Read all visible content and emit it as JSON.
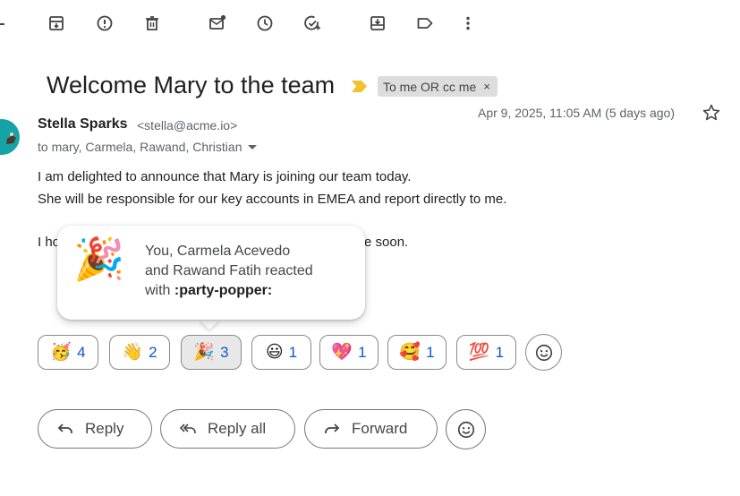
{
  "toolbar": {
    "icons": [
      "archive-icon",
      "report-spam-icon",
      "delete-icon",
      "mark-unread-icon",
      "snooze-icon",
      "add-to-tasks-icon",
      "move-to-icon",
      "label-icon",
      "more-icon"
    ]
  },
  "email": {
    "subject": "Welcome Mary to the team",
    "label_chip": "To me OR cc me",
    "label_chip_close": "×",
    "sender_name": "Stella Sparks",
    "sender_email": "<stella@acme.io>",
    "recipients": "to mary, Carmela, Rawand, Christian",
    "date": "Apr 9, 2025, 11:05 AM (5 days ago)",
    "body": {
      "line1": "I am delighted to announce that Mary is joining our team today.",
      "line2": "She will be responsible for our key accounts in EMEA and report directly to me.",
      "line3_start": "I ho",
      "line3_end": "e soon."
    }
  },
  "tooltip": {
    "emoji": "🎉",
    "line1": "You, Carmela Acevedo",
    "line2": "and Rawand Fatih reacted",
    "line3_prefix": "with ",
    "line3_code": ":party-popper:"
  },
  "reactions": [
    {
      "emoji": "🥳",
      "count": "4"
    },
    {
      "emoji": "👋",
      "count": "2"
    },
    {
      "emoji": "🎉",
      "count": "3"
    },
    {
      "emoji": "😃",
      "count": "1"
    },
    {
      "emoji": "💖",
      "count": "1"
    },
    {
      "emoji": "🥰",
      "count": "1"
    },
    {
      "emoji": "💯",
      "count": "1"
    }
  ],
  "actions": {
    "reply": "Reply",
    "reply_all": "Reply all",
    "forward": "Forward"
  },
  "colors": {
    "count_blue": "#0b57d0",
    "avatar_teal": "#16a3a8",
    "important_yellow": "#f2c12e"
  }
}
